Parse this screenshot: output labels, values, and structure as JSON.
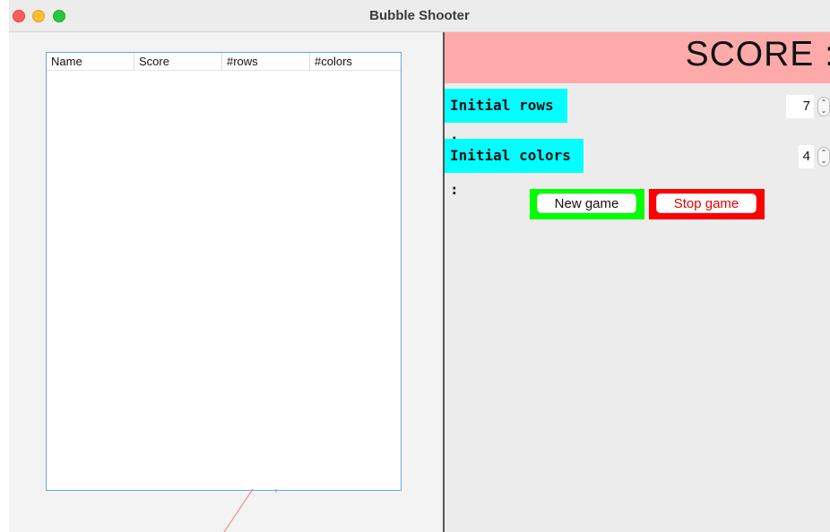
{
  "window": {
    "title": "Bubble Shooter"
  },
  "scores_table": {
    "columns": [
      "Name",
      "Score",
      "#rows",
      "#colors"
    ],
    "rows": []
  },
  "score_panel": {
    "label": "SCORE :"
  },
  "settings": {
    "rows": {
      "label": "Initial rows :",
      "value": "7"
    },
    "colors": {
      "label": "Initial colors :",
      "value": "4"
    }
  },
  "buttons": {
    "new_game": "New game",
    "stop_game": "Stop game"
  },
  "colors": {
    "score_bar": "#ffaaaa",
    "settings_label": "#00ffff",
    "new_game_frame": "#00ff00",
    "stop_game_frame": "#ff0000",
    "stop_game_text": "#e40000"
  }
}
